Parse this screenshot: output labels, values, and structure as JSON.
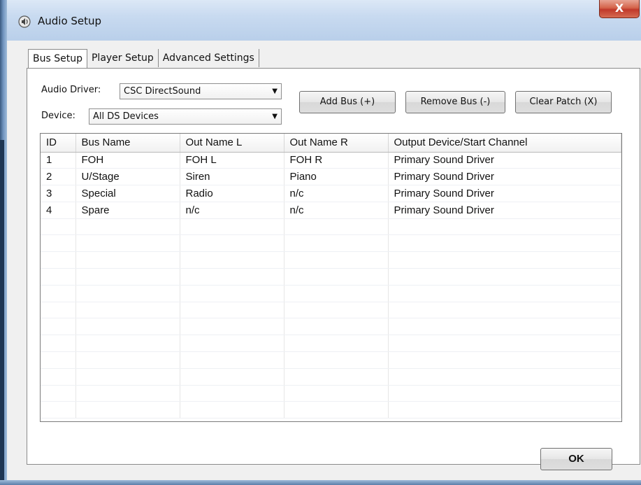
{
  "window": {
    "title": "Audio Setup",
    "close_label": "X"
  },
  "tabs": [
    {
      "label": "Bus Setup",
      "active": true
    },
    {
      "label": "Player Setup",
      "active": false
    },
    {
      "label": "Advanced Settings",
      "active": false
    }
  ],
  "bus_setup": {
    "audio_driver_label": "Audio Driver:",
    "audio_driver_value": "CSC DirectSound",
    "device_label": "Device:",
    "device_value": "All DS Devices",
    "add_bus_label": "Add Bus (+)",
    "remove_bus_label": "Remove Bus (-)",
    "clear_patch_label": "Clear Patch (X)"
  },
  "bus_table": {
    "columns": [
      "ID",
      "Bus Name",
      "Out Name L",
      "Out Name R",
      "Output Device/Start Channel"
    ],
    "rows": [
      [
        "1",
        "FOH",
        "FOH L",
        "FOH R",
        "Primary Sound Driver"
      ],
      [
        "2",
        "U/Stage",
        "Siren",
        "Piano",
        "Primary Sound Driver"
      ],
      [
        "3",
        "Special",
        "Radio",
        "n/c",
        "Primary Sound Driver"
      ],
      [
        "4",
        "Spare",
        "n/c",
        "n/c",
        "Primary Sound Driver"
      ]
    ]
  },
  "footer": {
    "ok_label": "OK"
  },
  "colors": {
    "titlebar": "#c8daf0",
    "close_button": "#c0392b",
    "dialog_bg": "#f0f0f0"
  },
  "icons": {
    "app": "speaker-icon",
    "close": "close-icon",
    "dropdown": "chevron-down-icon"
  }
}
